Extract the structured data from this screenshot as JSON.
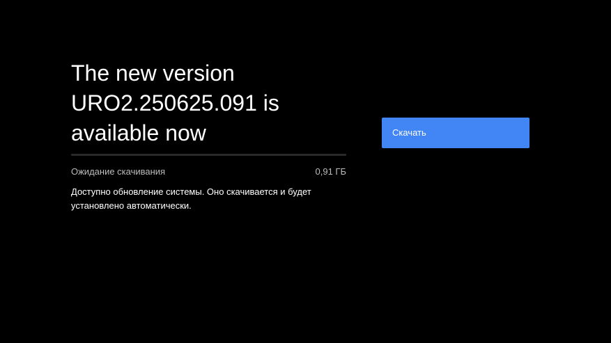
{
  "update": {
    "title_lines": [
      "The new version",
      "URO2.250625.091 is",
      "available now"
    ],
    "progress_percent": 0,
    "status": "Ожидание скачивания",
    "size": "0,91 ГБ",
    "description": "Доступно обновление системы. Оно скачивается и будет установлено автоматически."
  },
  "actions": {
    "download_label": "Скачать"
  },
  "colors": {
    "background": "#000000",
    "button": "#4285f4",
    "progress_track": "#2a2a2a",
    "secondary_text": "#bdbdbd"
  }
}
